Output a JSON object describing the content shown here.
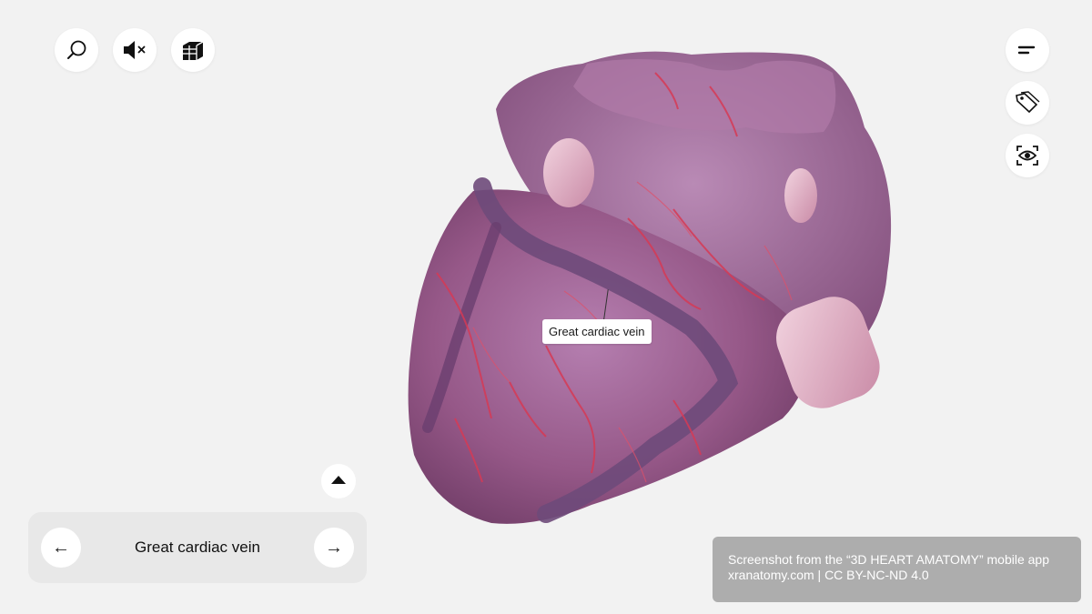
{
  "toolbar": {
    "left_icons": [
      "search-icon",
      "mute-icon",
      "layers-icon"
    ],
    "right_icons": [
      "menu-icon",
      "tag-icon",
      "view-icon"
    ]
  },
  "model": {
    "label": "Great cardiac vein"
  },
  "navigator": {
    "title": "Great cardiac vein",
    "prev_glyph": "←",
    "next_glyph": "→"
  },
  "credit": {
    "line1": "Screenshot from the “3D HEART AMATOMY” mobile app",
    "line2": "xranatomy.com | CC BY-NC-ND 4.0"
  },
  "colors": {
    "background": "#f2f2f2",
    "heart": "#9a5a8a",
    "vessel": "#d63a55",
    "vein": "#6e4a7a",
    "credit_bg": "#adadad"
  }
}
